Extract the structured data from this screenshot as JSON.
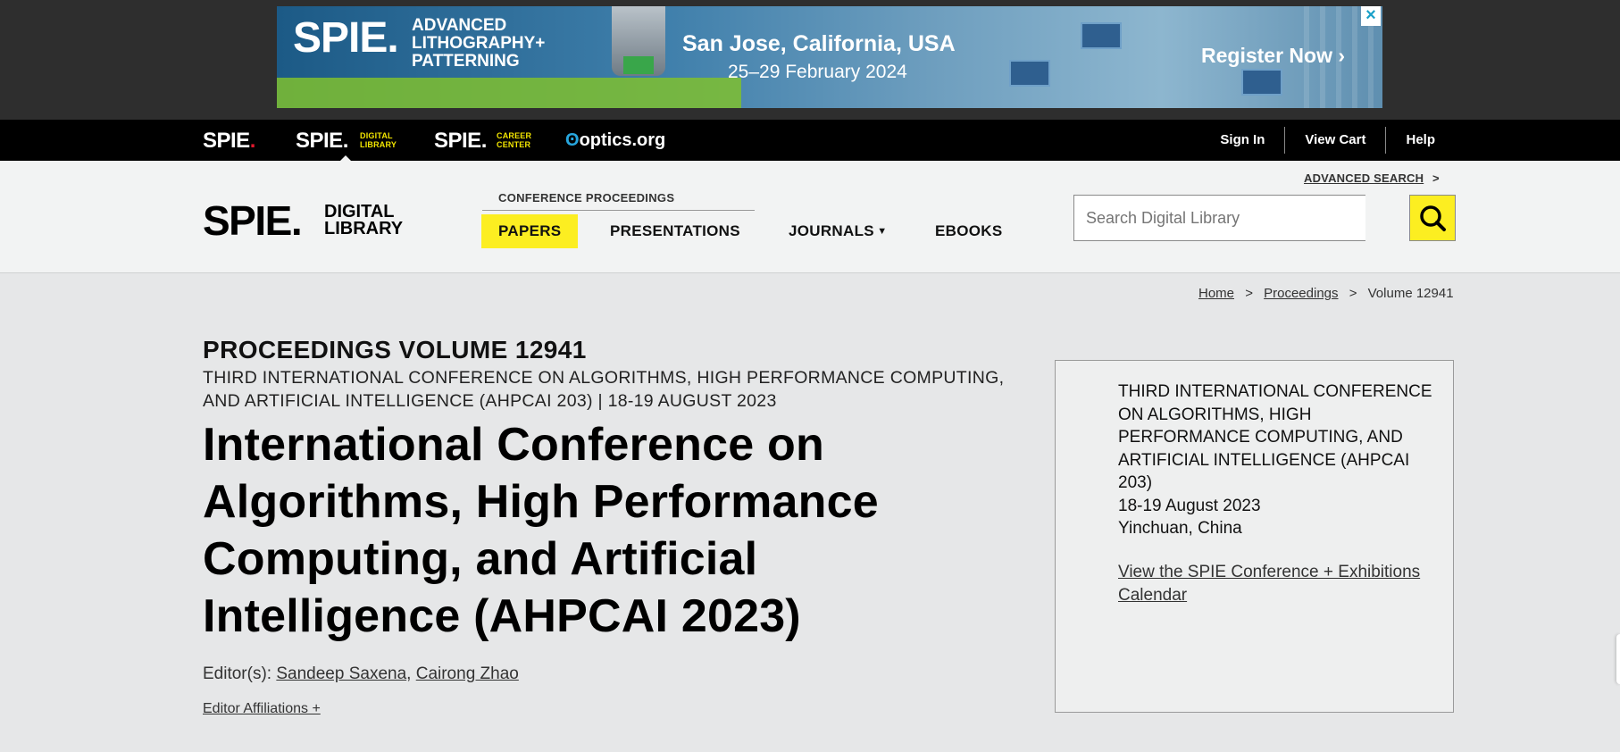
{
  "ad": {
    "brand": "SPIE.",
    "title_lines": [
      "ADVANCED",
      "LITHOGRAPHY+",
      "PATTERNING"
    ],
    "location": "San Jose, California, USA",
    "dates": "25–29 February 2024",
    "cta": "Register Now ›",
    "close_icon": "close-icon"
  },
  "topbar": {
    "brands": [
      {
        "name": "SPIE.",
        "sub": ""
      },
      {
        "name": "SPIE.",
        "sub": "DIGITAL LIBRARY"
      },
      {
        "name": "SPIE.",
        "sub": "CAREER CENTER"
      },
      {
        "name": "optics.org"
      }
    ],
    "links": [
      "Sign In",
      "View Cart",
      "Help"
    ]
  },
  "header": {
    "logo_big": "SPIE.",
    "logo_small": "DIGITAL LIBRARY",
    "nav_label": "CONFERENCE PROCEEDINGS",
    "nav": [
      "PAPERS",
      "PRESENTATIONS",
      "JOURNALS",
      "EBOOKS"
    ],
    "search_placeholder": "Search Digital Library",
    "advanced_search": "ADVANCED SEARCH",
    "advanced_arrow": ">"
  },
  "breadcrumb": [
    "Home",
    "Proceedings",
    "Volume 12941"
  ],
  "main": {
    "volume": "PROCEEDINGS VOLUME 12941",
    "subtitle": "THIRD INTERNATIONAL CONFERENCE ON ALGORITHMS, HIGH PERFORMANCE COMPUTING, AND ARTIFICIAL INTELLIGENCE (AHPCAI 203) | 18-19 AUGUST 2023",
    "title": "International Conference on Algorithms, High Performance Computing, and Artificial Intelligence (AHPCAI 2023)",
    "editors_label": "Editor(s):",
    "editors": [
      "Sandeep Saxena",
      "Cairong Zhao"
    ],
    "affiliations": "Editor Affiliations +"
  },
  "sidebar": {
    "conference": "THIRD INTERNATIONAL CONFERENCE ON ALGORITHMS, HIGH PERFORMANCE COMPUTING, AND ARTIFICIAL INTELLIGENCE (AHPCAI 203)",
    "dates": "18-19 August 2023",
    "location": "Yinchuan, China",
    "calendar_link": "View the SPIE Conference + Exhibitions Calendar"
  }
}
